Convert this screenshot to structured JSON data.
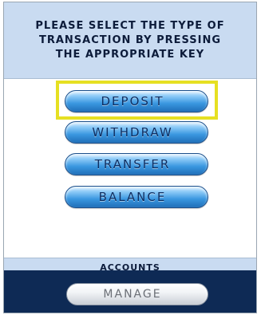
{
  "header": {
    "title": "PLEASE SELECT THE TYPE OF\nTRANSACTION BY PRESSING\nTHE APPROPRIATE KEY"
  },
  "menu": {
    "buttons": [
      {
        "label": "DEPOSIT",
        "highlighted": true
      },
      {
        "label": "WITHDRAW",
        "highlighted": false
      },
      {
        "label": "TRANSFER",
        "highlighted": false
      },
      {
        "label": "BALANCE",
        "highlighted": false
      }
    ]
  },
  "accounts": {
    "label": "ACCOUNTS",
    "manage_label": "MANAGE"
  },
  "colors": {
    "header_bg": "#c9dbf1",
    "footer_bg": "#0e2a55",
    "button_blue": "#3a97e0",
    "highlight": "#e6e022"
  }
}
